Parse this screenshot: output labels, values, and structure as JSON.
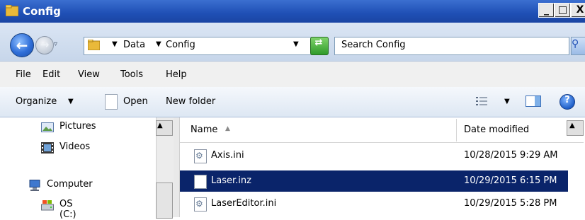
{
  "window": {
    "title": "Config",
    "caption_buttons": {
      "minimize": "_",
      "maximize": "□",
      "close": "X"
    }
  },
  "address_bar": {
    "breadcrumb": [
      "Data",
      "Config"
    ],
    "search_placeholder": "Search Config"
  },
  "menu": [
    {
      "label": "File"
    },
    {
      "label": "Edit"
    },
    {
      "label": "View"
    },
    {
      "label": "Tools"
    },
    {
      "label": "Help"
    }
  ],
  "command_bar": {
    "organize": "Organize",
    "open": "Open",
    "new_folder": "New folder"
  },
  "nav_pane": {
    "items": [
      {
        "label": "Pictures",
        "icon": "pictures-icon"
      },
      {
        "label": "Videos",
        "icon": "videos-icon"
      },
      {
        "label": "Computer",
        "icon": "computer-icon"
      },
      {
        "label": "OS (C:)",
        "icon": "drive-icon"
      }
    ]
  },
  "file_list": {
    "columns": {
      "name": "Name",
      "date": "Date modified"
    },
    "rows": [
      {
        "name": "Axis.ini",
        "date": "10/28/2015 9:29 AM",
        "selected": false
      },
      {
        "name": "Laser.inz",
        "date": "10/29/2015 6:15 PM",
        "selected": true
      },
      {
        "name": "LaserEditor.ini",
        "date": "10/29/2015 5:28 PM",
        "selected": false
      }
    ]
  },
  "colors": {
    "title_bar": "#1f4fb5",
    "selection": "#0a246a"
  }
}
